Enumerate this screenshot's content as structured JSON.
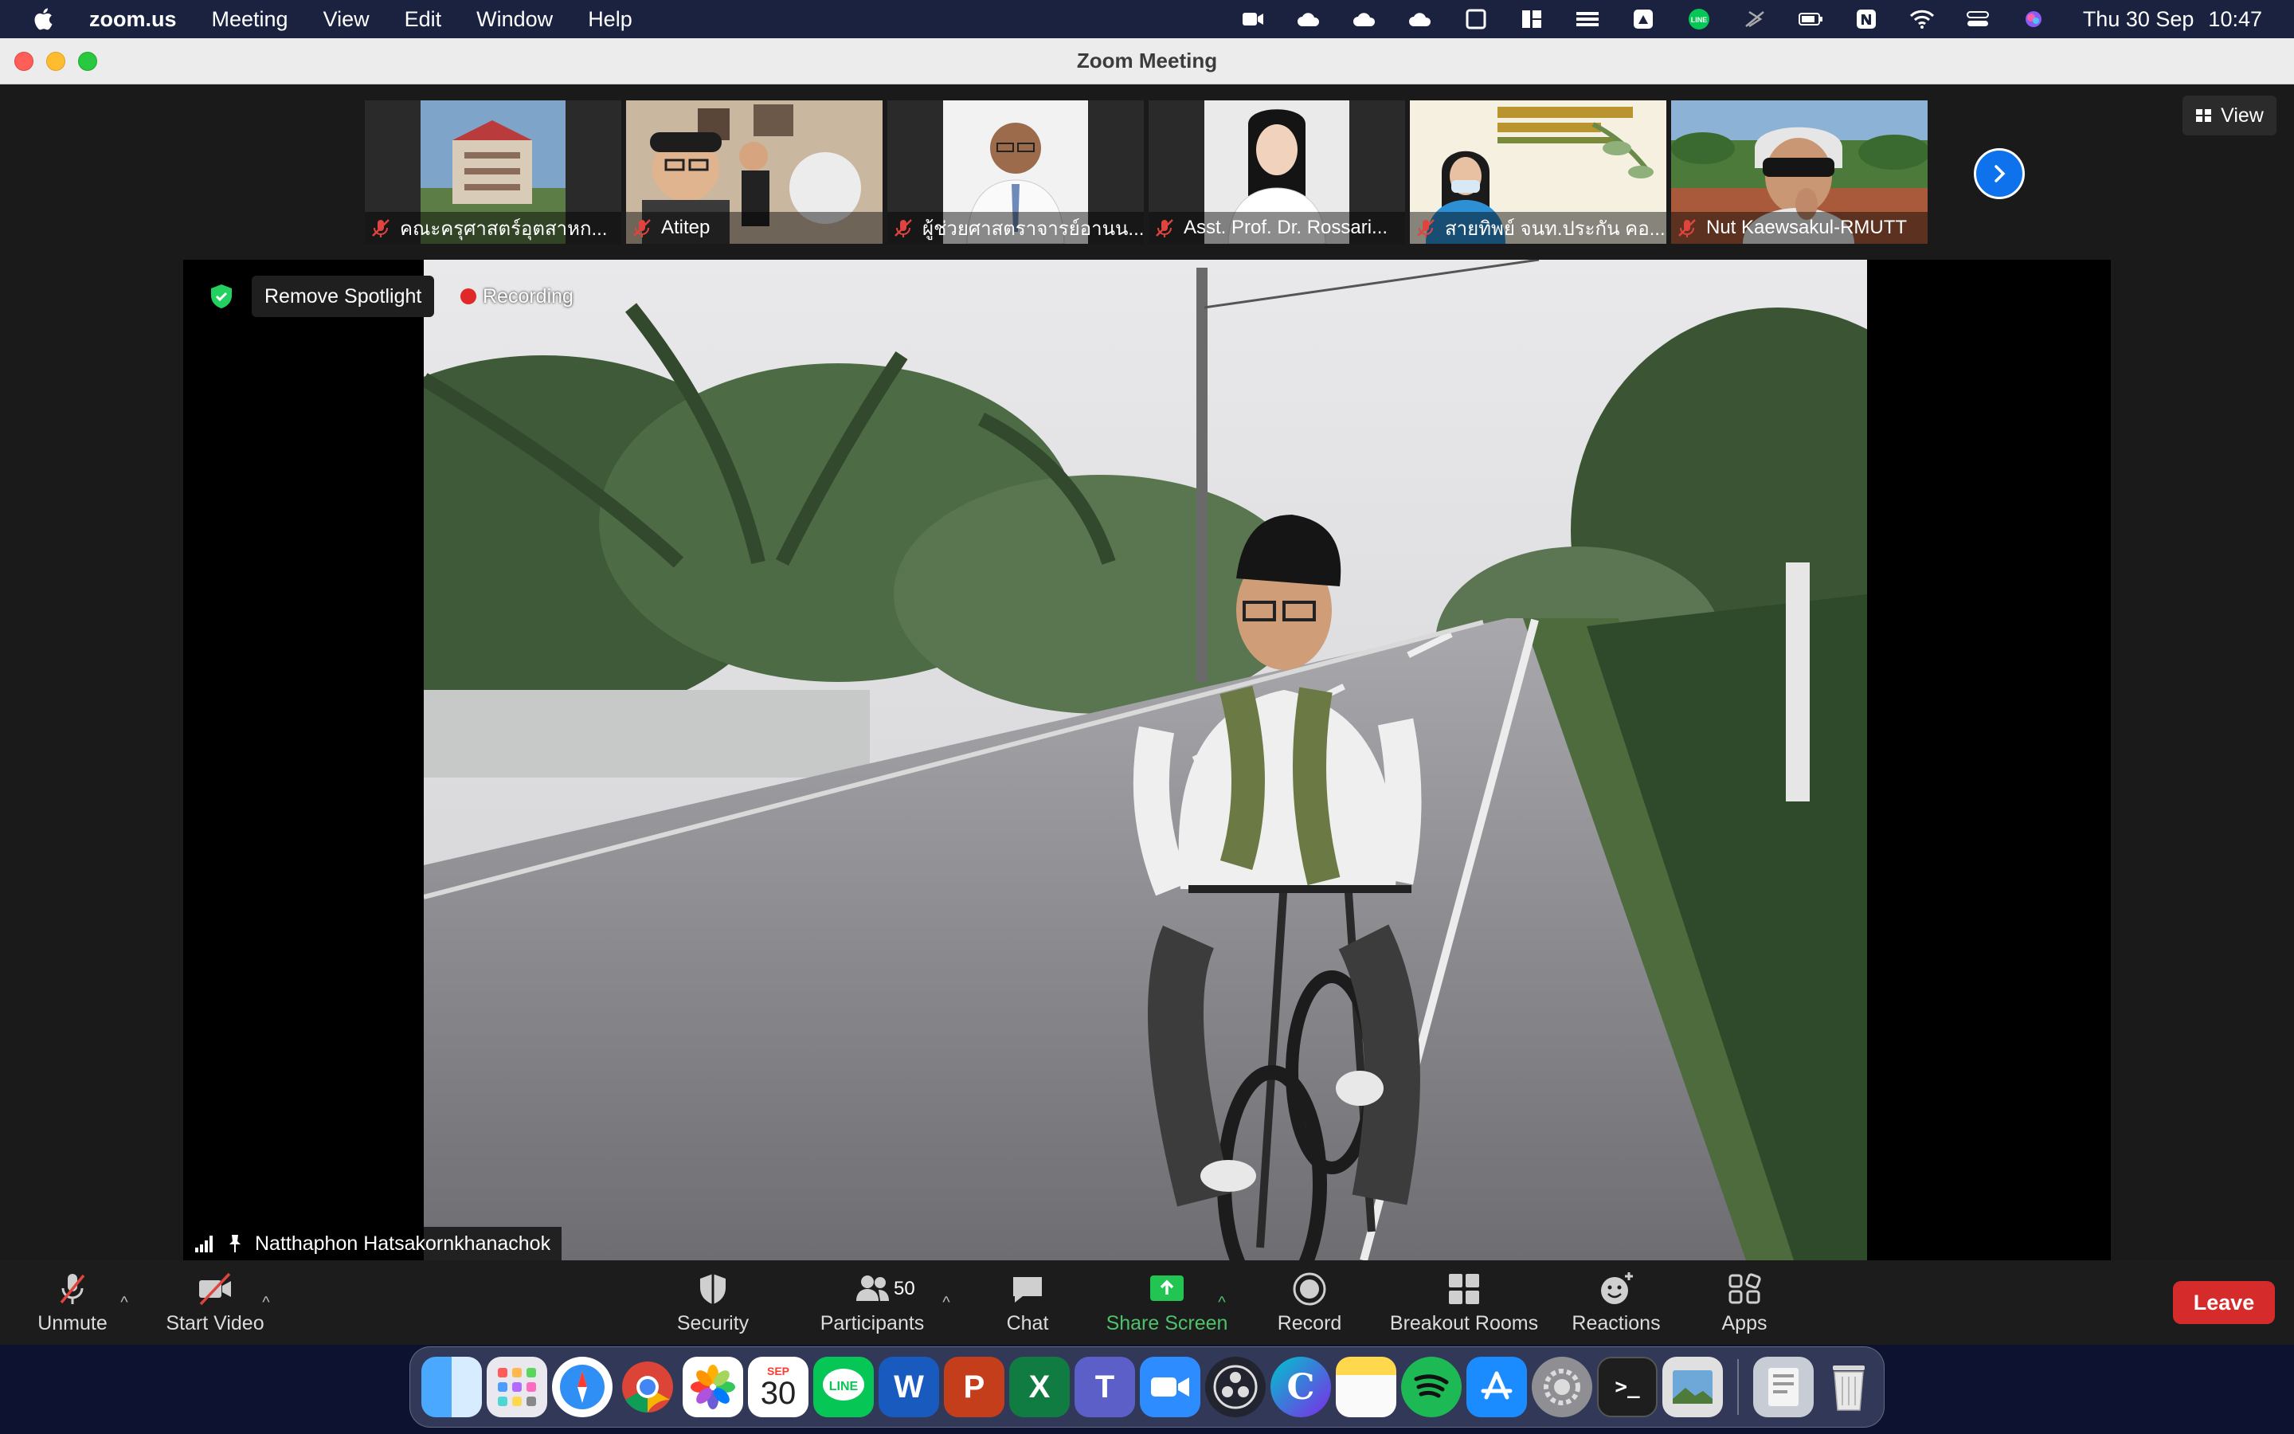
{
  "menubar": {
    "app": "zoom.us",
    "items": [
      "Meeting",
      "View",
      "Edit",
      "Window",
      "Help"
    ],
    "date": "Thu 30 Sep",
    "time": "10:47"
  },
  "window": {
    "title": "Zoom Meeting"
  },
  "view_button": {
    "label": "View"
  },
  "thumbnails": [
    {
      "name": "คณะครุศาสตร์อุตสาหก..."
    },
    {
      "name": "Atitep"
    },
    {
      "name": "ผู้ช่วยศาสตราจารย์อานน..."
    },
    {
      "name": "Asst. Prof. Dr. Rossari..."
    },
    {
      "name": "สายทิพย์ จนท.ประกัน คอ..."
    },
    {
      "name": "Nut Kaewsakul-RMUTT"
    }
  ],
  "spotlight": {
    "remove_label": "Remove Spotlight",
    "recording_label": "Recording",
    "speaker_name": "Natthaphon Hatsakornkhanachok"
  },
  "toolbar": {
    "unmute": "Unmute",
    "start_video": "Start Video",
    "security": "Security",
    "participants": "Participants",
    "participants_count": "50",
    "chat": "Chat",
    "share_screen": "Share Screen",
    "record": "Record",
    "breakout_rooms": "Breakout Rooms",
    "reactions": "Reactions",
    "apps": "Apps",
    "leave": "Leave"
  },
  "dock": {
    "calendar_month": "SEP",
    "calendar_day": "30",
    "items": [
      "finder-icon",
      "launchpad-icon",
      "safari-icon",
      "chrome-icon",
      "photos-icon",
      "calendar-icon",
      "line-icon",
      "word-icon",
      "powerpoint-icon",
      "excel-icon",
      "teams-icon",
      "zoom-icon",
      "obs-icon",
      "canva-icon",
      "notes-icon",
      "spotify-icon",
      "app-store-icon",
      "system-preferences-icon",
      "terminal-icon",
      "preview-icon",
      "downloads-icon",
      "trash-icon"
    ]
  },
  "colors": {
    "menubar": "#1a2240",
    "share_green": "#4ec26a",
    "leave_red": "#d52b2b",
    "accent_blue": "#0e72ed"
  }
}
